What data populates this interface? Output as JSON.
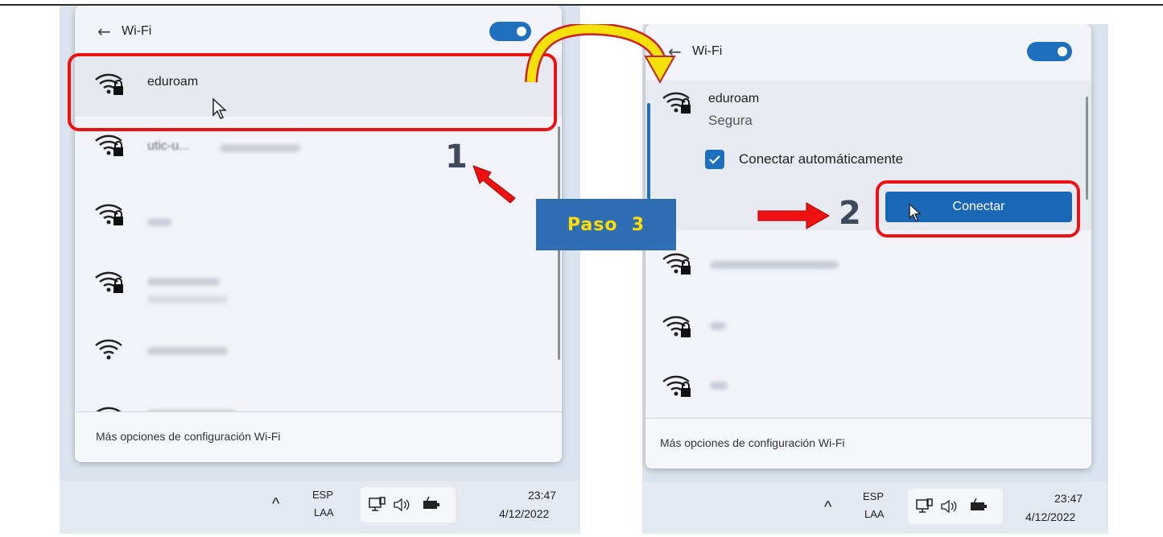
{
  "colors": {
    "accent": "#1f6fbf",
    "highlight": "#ee1111",
    "paso_bg": "#2f6db4",
    "paso_text": "#ffdd00"
  },
  "left": {
    "header": {
      "back_icon": "back-arrow-icon",
      "title": "Wi-Fi",
      "toggle_on": true
    },
    "networks": [
      {
        "name": "eduroam",
        "icon": "wifi-secured-icon",
        "highlighted": true
      },
      {
        "name": "utic-u...",
        "icon": "wifi-secured-icon"
      },
      {
        "name": "",
        "icon": "wifi-secured-icon"
      },
      {
        "name": "",
        "icon": "wifi-secured-icon"
      },
      {
        "name": "",
        "icon": "wifi-open-icon"
      },
      {
        "name": "",
        "icon": "wifi-open-icon"
      }
    ],
    "footer": "Más opciones de configuración Wi-Fi",
    "step": "1"
  },
  "right": {
    "header": {
      "back_icon": "back-arrow-icon",
      "title": "Wi-Fi",
      "toggle_on": true
    },
    "selected": {
      "name": "eduroam",
      "status": "Segura",
      "auto_connect_label": "Conectar automáticamente",
      "auto_connect_checked": true,
      "connect_button": "Conectar"
    },
    "networks": [
      {
        "name": "",
        "icon": "wifi-secured-icon"
      },
      {
        "name": "",
        "icon": "wifi-secured-icon"
      },
      {
        "name": "",
        "icon": "wifi-secured-icon"
      }
    ],
    "footer": "Más opciones de configuración Wi-Fi",
    "step": "2"
  },
  "paso_label": "Paso  3",
  "taskbar": {
    "lang_top": "ESP",
    "lang_bottom": "LAA",
    "time": "23:47",
    "date": "4/12/2022",
    "chevron": "^"
  }
}
